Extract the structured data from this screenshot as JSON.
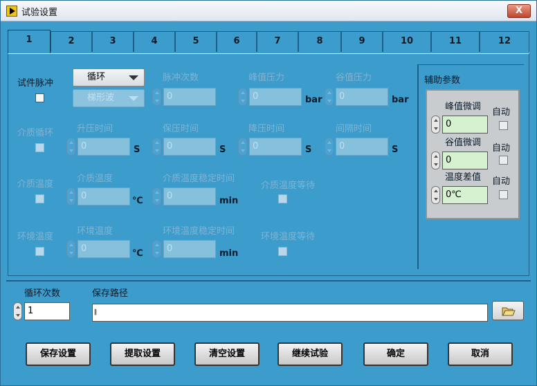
{
  "window": {
    "title": "试验设置",
    "close_glyph": "X"
  },
  "tabs": [
    "1",
    "2",
    "3",
    "4",
    "5",
    "6",
    "7",
    "8",
    "9",
    "10",
    "11",
    "12"
  ],
  "pulse": {
    "label": "试件脉冲",
    "mode_ring": "循环",
    "wave_ring": "梯形波",
    "count_label": "脉冲次数",
    "count_value": "0",
    "peak_label": "峰值压力",
    "peak_value": "0",
    "peak_unit": "bar",
    "valley_label": "谷值压力",
    "valley_value": "0",
    "valley_unit": "bar"
  },
  "medium_cycle": {
    "label": "介质循环",
    "rise_label": "升压时间",
    "rise_value": "0",
    "rise_unit": "S",
    "hold_label": "保压时间",
    "hold_value": "0",
    "hold_unit": "S",
    "drop_label": "降压时间",
    "drop_value": "0",
    "drop_unit": "S",
    "interval_label": "间隔时间",
    "interval_value": "0",
    "interval_unit": "S"
  },
  "medium_temp": {
    "label": "介质温度",
    "temp_label": "介质温度",
    "temp_value": "0",
    "temp_unit": "℃",
    "stable_label": "介质温度稳定时间",
    "stable_value": "0",
    "stable_unit": "min",
    "wait_label": "介质温度等待"
  },
  "env_temp": {
    "label": "环境温度",
    "temp_label": "环境温度",
    "temp_value": "0",
    "temp_unit": "℃",
    "stable_label": "环境温度稳定时间",
    "stable_value": "0",
    "stable_unit": "min",
    "wait_label": "环境温度等待"
  },
  "aux": {
    "title": "辅助参数",
    "peak_adj_label": "峰值微调",
    "peak_adj_value": "0",
    "valley_adj_label": "谷值微调",
    "valley_adj_value": "0",
    "temp_diff_label": "温度差值",
    "temp_diff_value": "0℃",
    "auto_label": "自动"
  },
  "bottom": {
    "cycles_label": "循环次数",
    "cycles_value": "1",
    "path_label": "保存路径",
    "path_value": "",
    "path_icon": "𝄃"
  },
  "buttons": {
    "save": "保存设置",
    "load": "提取设置",
    "clear": "清空设置",
    "continue": "继续试验",
    "ok": "确定",
    "cancel": "取消"
  },
  "colors": {
    "panel": "#3c9ccc",
    "active_field": "#d6f1cf"
  }
}
